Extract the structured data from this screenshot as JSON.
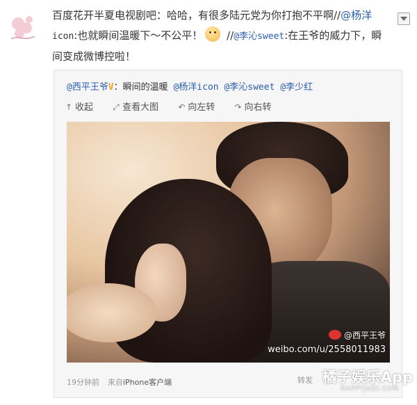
{
  "post": {
    "line1_text": "百度花开半夏电视剧吧：哈哈，有很多陆元党为你打抱不平啊//",
    "line1_link": "@杨洋",
    "line2_mono": "icon",
    "line2_text": ":也就瞬间温暖下～不公平！",
    "line2_sep": " //",
    "line2_link": "@李沁sweet",
    "line2_tail": ":在王爷的威力下，瞬",
    "line3_text": "间变成微博控啦！"
  },
  "box": {
    "author": "@西平王爷",
    "crown": "V",
    "header_text": "：瞬间的温暖 ",
    "mention1": "@杨洋icon",
    "mention2": "@李沁sweet",
    "mention3": "@李少红",
    "toolbar": [
      {
        "icon": "↑",
        "label": "收起"
      },
      {
        "icon": "⤢",
        "label": "查看大图"
      },
      {
        "icon": "↶",
        "label": "向左转"
      },
      {
        "icon": "↷",
        "label": "向右转"
      }
    ],
    "watermark_name": "@西平王爷",
    "watermark_url": "weibo.com/u/2558011983",
    "time": "19分钟前",
    "source_prefix": "来自",
    "source": "iPhone客户端"
  },
  "repost_label": "转发",
  "brand": {
    "name": "橘子娱乐App",
    "sub": "HAPPYJUZI.COM"
  },
  "colors": {
    "link": "#2a5db0",
    "crown": "#f4a11c"
  }
}
